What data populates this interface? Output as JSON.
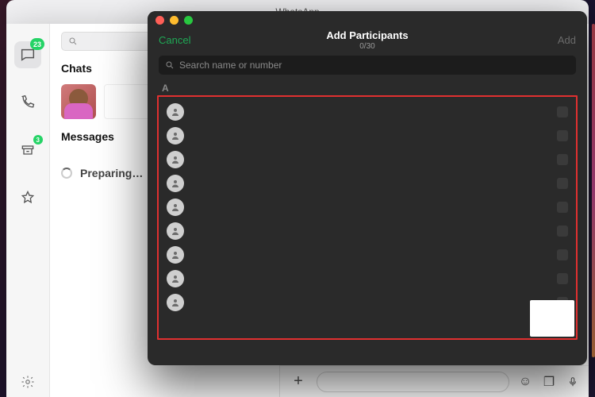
{
  "app": {
    "title": "WhatsApp"
  },
  "rail": {
    "chats_badge": "23",
    "archive_badge": "3"
  },
  "sidebar": {
    "search_placeholder": "",
    "section_chats": "Chats",
    "section_messages": "Messages",
    "loading_text": "Preparing…"
  },
  "composer": {
    "placeholder": ""
  },
  "modal": {
    "cancel": "Cancel",
    "title": "Add Participants",
    "subtitle": "0/30",
    "add": "Add",
    "search_placeholder": "Search name or number",
    "section_letter": "A",
    "contacts": [
      {
        "name": ""
      },
      {
        "name": ""
      },
      {
        "name": ""
      },
      {
        "name": ""
      },
      {
        "name": ""
      },
      {
        "name": ""
      },
      {
        "name": ""
      },
      {
        "name": ""
      },
      {
        "name": ""
      }
    ]
  }
}
